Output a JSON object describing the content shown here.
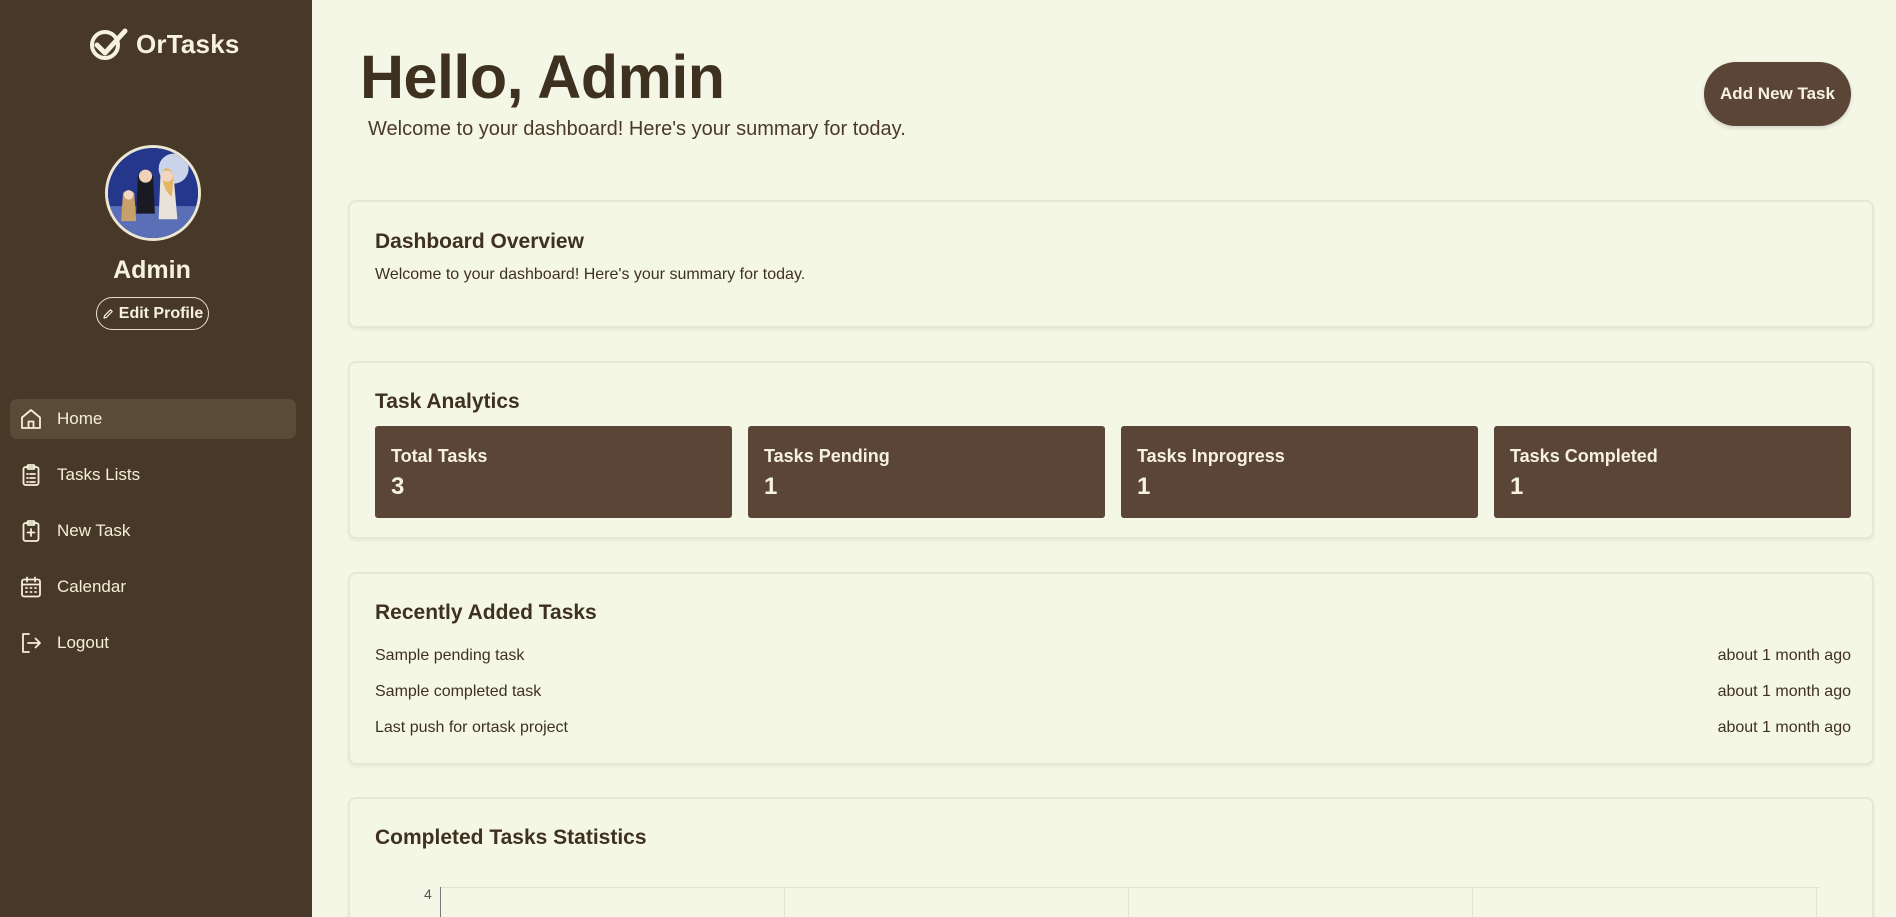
{
  "brand": {
    "name": "OrTasks"
  },
  "profile": {
    "name": "Admin",
    "edit_label": "Edit Profile"
  },
  "nav": [
    {
      "label": "Home",
      "icon": "home-icon",
      "active": true
    },
    {
      "label": "Tasks Lists",
      "icon": "clipboard-list-icon",
      "active": false
    },
    {
      "label": "New Task",
      "icon": "clipboard-plus-icon",
      "active": false
    },
    {
      "label": "Calendar",
      "icon": "calendar-icon",
      "active": false
    },
    {
      "label": "Logout",
      "icon": "logout-icon",
      "active": false
    }
  ],
  "header": {
    "greeting": "Hello, Admin",
    "subtitle": "Welcome to your dashboard! Here's your summary for today.",
    "add_button": "Add New Task"
  },
  "overview": {
    "title": "Dashboard Overview",
    "text": "Welcome to your dashboard! Here's your summary for today."
  },
  "analytics": {
    "title": "Task Analytics",
    "stats": [
      {
        "label": "Total Tasks",
        "value": "3"
      },
      {
        "label": "Tasks Pending",
        "value": "1"
      },
      {
        "label": "Tasks Inprogress",
        "value": "1"
      },
      {
        "label": "Tasks Completed",
        "value": "1"
      }
    ]
  },
  "recent": {
    "title": "Recently Added Tasks",
    "tasks": [
      {
        "name": "Sample pending task",
        "time": "about 1 month ago"
      },
      {
        "name": "Sample completed task",
        "time": "about 1 month ago"
      },
      {
        "name": "Last push for ortask project",
        "time": "about 1 month ago"
      }
    ]
  },
  "stats": {
    "title": "Completed Tasks Statistics",
    "y_tick_top": "4"
  },
  "colors": {
    "sidebar": "#473827",
    "background": "#f5f7e6",
    "accent": "#5a4537",
    "text": "#3f3120"
  }
}
